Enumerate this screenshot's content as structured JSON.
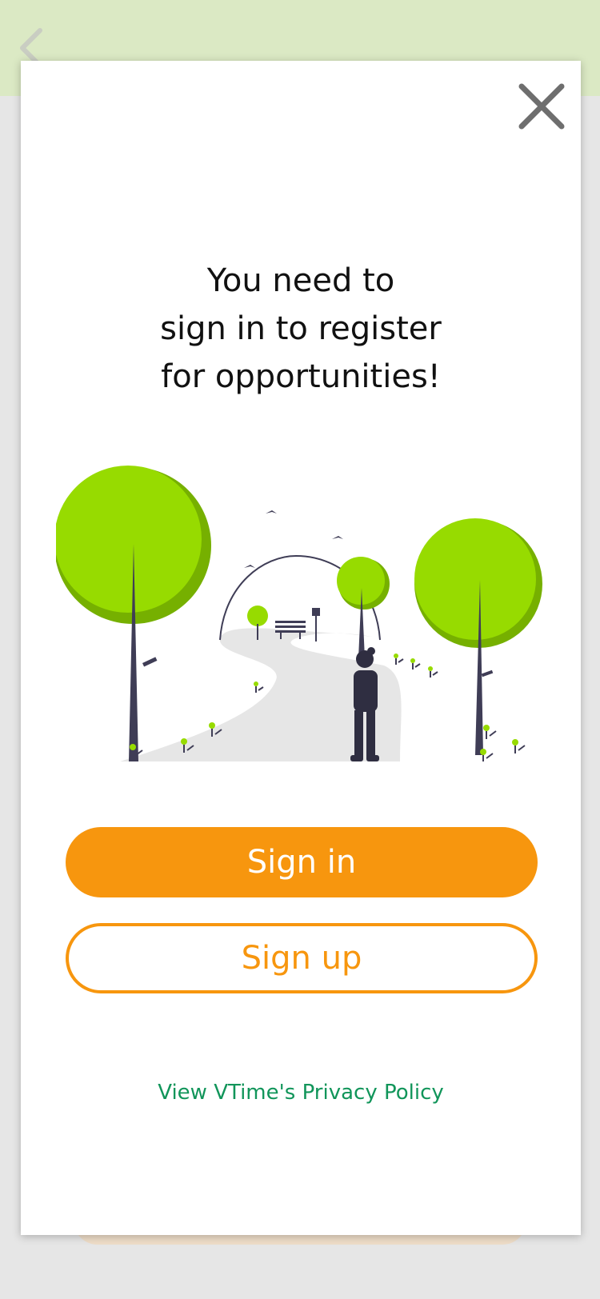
{
  "header": {
    "back_icon": "chevron-left-icon",
    "color": "#dbe9c4"
  },
  "modal": {
    "close_icon": "close-icon",
    "title_lines": [
      "You need to",
      "sign in to register",
      "for opportunities!"
    ],
    "illustration": "person-walking-path-in-park",
    "signin_label": "Sign in",
    "signup_label": "Sign up",
    "privacy_link": "View VTime's Privacy Policy"
  },
  "colors": {
    "accent": "#f7960e",
    "link": "#11955a",
    "tree_light": "#97db00",
    "tree_dark": "#76b000",
    "overlay": "#e6e6e6"
  }
}
